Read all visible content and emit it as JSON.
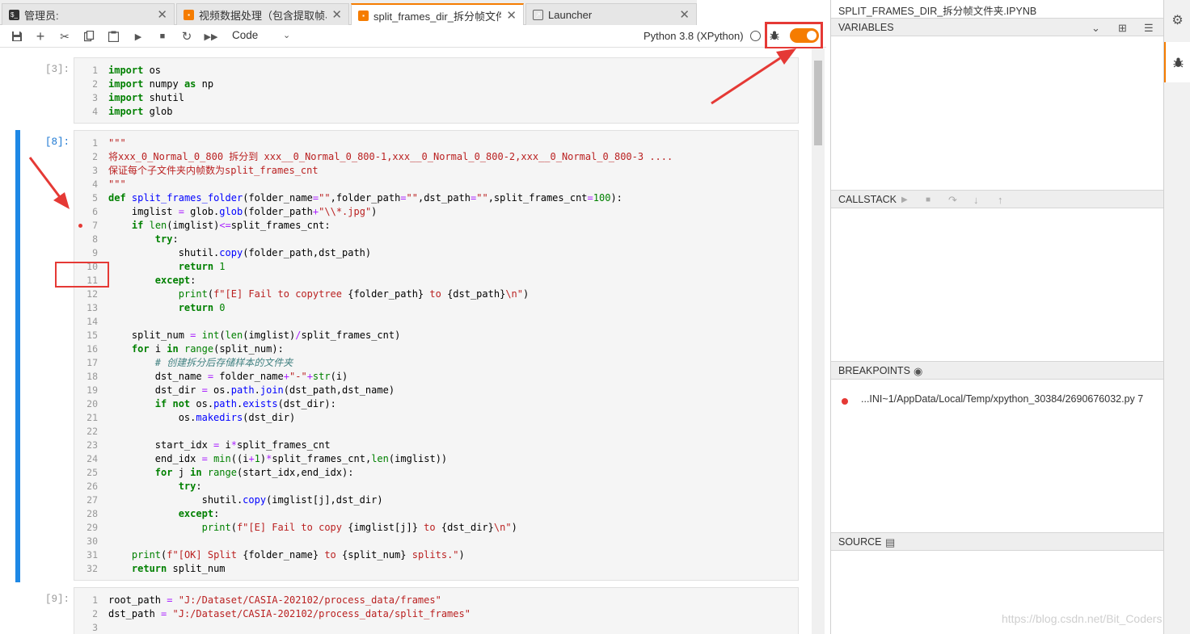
{
  "tabs": [
    {
      "label": "管理员:",
      "icon": "terminal-icon",
      "active": false
    },
    {
      "label": "视频数据处理（包含提取帧、",
      "icon": "notebook-icon",
      "active": false
    },
    {
      "label": "split_frames_dir_拆分帧文件夹",
      "icon": "notebook-icon",
      "active": true
    },
    {
      "label": "Launcher",
      "icon": "launcher-icon",
      "active": false
    }
  ],
  "toolbar": {
    "cell_type": "Code",
    "kernel_name": "Python 3.8 (XPython)"
  },
  "cells": [
    {
      "prompt": "[3]:",
      "lines": [
        [
          [
            "kw",
            "import"
          ],
          [
            "t",
            " os"
          ]
        ],
        [
          [
            "kw",
            "import"
          ],
          [
            "t",
            " numpy "
          ],
          [
            "kw",
            "as"
          ],
          [
            "t",
            " np"
          ]
        ],
        [
          [
            "kw",
            "import"
          ],
          [
            "t",
            " shutil"
          ]
        ],
        [
          [
            "kw",
            "import"
          ],
          [
            "t",
            " glob"
          ]
        ]
      ]
    },
    {
      "prompt": "[8]:",
      "breakpoint_line": 7,
      "lines": [
        [
          [
            "str",
            "\"\"\""
          ]
        ],
        [
          [
            "str",
            "将xxx_0_Normal_0_800 拆分到 xxx__0_Normal_0_800-1,xxx__0_Normal_0_800-2,xxx__0_Normal_0_800-3 ...."
          ]
        ],
        [
          [
            "str",
            "保证每个子文件夹内帧数为split_frames_cnt"
          ]
        ],
        [
          [
            "str",
            "\"\"\""
          ]
        ],
        [
          [
            "kw",
            "def"
          ],
          [
            "t",
            " "
          ],
          [
            "fn",
            "split_frames_folder"
          ],
          [
            "t",
            "(folder_name"
          ],
          [
            "op",
            "="
          ],
          [
            "str",
            "\"\""
          ],
          [
            "t",
            ",folder_path"
          ],
          [
            "op",
            "="
          ],
          [
            "str",
            "\"\""
          ],
          [
            "t",
            ",dst_path"
          ],
          [
            "op",
            "="
          ],
          [
            "str",
            "\"\""
          ],
          [
            "t",
            ",split_frames_cnt"
          ],
          [
            "op",
            "="
          ],
          [
            "num",
            "100"
          ],
          [
            "t",
            "):"
          ]
        ],
        [
          [
            "t",
            "    imglist "
          ],
          [
            "op",
            "="
          ],
          [
            "t",
            " glob."
          ],
          [
            "fn",
            "glob"
          ],
          [
            "t",
            "(folder_path"
          ],
          [
            "op",
            "+"
          ],
          [
            "str",
            "\"\\\\*.jpg\""
          ],
          [
            "t",
            ")"
          ]
        ],
        [
          [
            "t",
            "    "
          ],
          [
            "kw",
            "if"
          ],
          [
            "t",
            " "
          ],
          [
            "num",
            "len"
          ],
          [
            "t",
            "(imglist)"
          ],
          [
            "op",
            "<="
          ],
          [
            "t",
            "split_frames_cnt:"
          ]
        ],
        [
          [
            "t",
            "        "
          ],
          [
            "kw",
            "try"
          ],
          [
            "t",
            ":"
          ]
        ],
        [
          [
            "t",
            "            shutil."
          ],
          [
            "fn",
            "copy"
          ],
          [
            "t",
            "(folder_path,dst_path)"
          ]
        ],
        [
          [
            "t",
            "            "
          ],
          [
            "kw",
            "return"
          ],
          [
            "t",
            " "
          ],
          [
            "num",
            "1"
          ]
        ],
        [
          [
            "t",
            "        "
          ],
          [
            "kw",
            "except"
          ],
          [
            "t",
            ":"
          ]
        ],
        [
          [
            "t",
            "            "
          ],
          [
            "num",
            "print"
          ],
          [
            "t",
            "("
          ],
          [
            "str",
            "f\"[E] Fail to copytree "
          ],
          [
            "t",
            "{folder_path}"
          ],
          [
            "str",
            " to "
          ],
          [
            "t",
            "{dst_path}"
          ],
          [
            "str",
            "\\n\""
          ],
          [
            "t",
            ")"
          ]
        ],
        [
          [
            "t",
            "            "
          ],
          [
            "kw",
            "return"
          ],
          [
            "t",
            " "
          ],
          [
            "num",
            "0"
          ]
        ],
        [],
        [
          [
            "t",
            "    split_num "
          ],
          [
            "op",
            "="
          ],
          [
            "t",
            " "
          ],
          [
            "num",
            "int"
          ],
          [
            "t",
            "("
          ],
          [
            "num",
            "len"
          ],
          [
            "t",
            "(imglist)"
          ],
          [
            "op",
            "/"
          ],
          [
            "t",
            "split_frames_cnt)"
          ]
        ],
        [
          [
            "t",
            "    "
          ],
          [
            "kw",
            "for"
          ],
          [
            "t",
            " i "
          ],
          [
            "kw",
            "in"
          ],
          [
            "t",
            " "
          ],
          [
            "num",
            "range"
          ],
          [
            "t",
            "(split_num):"
          ]
        ],
        [
          [
            "t",
            "        "
          ],
          [
            "cm",
            "# 创建拆分后存储样本的文件夹"
          ]
        ],
        [
          [
            "t",
            "        dst_name "
          ],
          [
            "op",
            "="
          ],
          [
            "t",
            " folder_name"
          ],
          [
            "op",
            "+"
          ],
          [
            "str",
            "\"-\""
          ],
          [
            "op",
            "+"
          ],
          [
            "num",
            "str"
          ],
          [
            "t",
            "(i)"
          ]
        ],
        [
          [
            "t",
            "        dst_dir "
          ],
          [
            "op",
            "="
          ],
          [
            "t",
            " os."
          ],
          [
            "fn",
            "path"
          ],
          [
            "t",
            "."
          ],
          [
            "fn",
            "join"
          ],
          [
            "t",
            "(dst_path,dst_name)"
          ]
        ],
        [
          [
            "t",
            "        "
          ],
          [
            "kw",
            "if not"
          ],
          [
            "t",
            " os."
          ],
          [
            "fn",
            "path"
          ],
          [
            "t",
            "."
          ],
          [
            "fn",
            "exists"
          ],
          [
            "t",
            "(dst_dir):"
          ]
        ],
        [
          [
            "t",
            "            os."
          ],
          [
            "fn",
            "makedirs"
          ],
          [
            "t",
            "(dst_dir)"
          ]
        ],
        [],
        [
          [
            "t",
            "        start_idx "
          ],
          [
            "op",
            "="
          ],
          [
            "t",
            " i"
          ],
          [
            "op",
            "*"
          ],
          [
            "t",
            "split_frames_cnt"
          ]
        ],
        [
          [
            "t",
            "        end_idx "
          ],
          [
            "op",
            "="
          ],
          [
            "t",
            " "
          ],
          [
            "num",
            "min"
          ],
          [
            "t",
            "((i"
          ],
          [
            "op",
            "+"
          ],
          [
            "num",
            "1"
          ],
          [
            "t",
            ")"
          ],
          [
            "op",
            "*"
          ],
          [
            "t",
            "split_frames_cnt,"
          ],
          [
            "num",
            "len"
          ],
          [
            "t",
            "(imglist))"
          ]
        ],
        [
          [
            "t",
            "        "
          ],
          [
            "kw",
            "for"
          ],
          [
            "t",
            " j "
          ],
          [
            "kw",
            "in"
          ],
          [
            "t",
            " "
          ],
          [
            "num",
            "range"
          ],
          [
            "t",
            "(start_idx,end_idx):"
          ]
        ],
        [
          [
            "t",
            "            "
          ],
          [
            "kw",
            "try"
          ],
          [
            "t",
            ":"
          ]
        ],
        [
          [
            "t",
            "                shutil."
          ],
          [
            "fn",
            "copy"
          ],
          [
            "t",
            "(imglist[j],dst_dir)"
          ]
        ],
        [
          [
            "t",
            "            "
          ],
          [
            "kw",
            "except"
          ],
          [
            "t",
            ":"
          ]
        ],
        [
          [
            "t",
            "                "
          ],
          [
            "num",
            "print"
          ],
          [
            "t",
            "("
          ],
          [
            "str",
            "f\"[E] Fail to copy "
          ],
          [
            "t",
            "{imglist[j]}"
          ],
          [
            "str",
            " to "
          ],
          [
            "t",
            "{dst_dir}"
          ],
          [
            "str",
            "\\n\""
          ],
          [
            "t",
            ")"
          ]
        ],
        [],
        [
          [
            "t",
            "    "
          ],
          [
            "num",
            "print"
          ],
          [
            "t",
            "("
          ],
          [
            "str",
            "f\"[OK] Split "
          ],
          [
            "t",
            "{folder_name}"
          ],
          [
            "str",
            " to "
          ],
          [
            "t",
            "{split_num}"
          ],
          [
            "str",
            " splits.\""
          ],
          [
            "t",
            ")"
          ]
        ],
        [
          [
            "t",
            "    "
          ],
          [
            "kw",
            "return"
          ],
          [
            "t",
            " split_num"
          ]
        ]
      ]
    },
    {
      "prompt": "[9]:",
      "lines": [
        [
          [
            "t",
            "root_path "
          ],
          [
            "op",
            "="
          ],
          [
            "t",
            " "
          ],
          [
            "str",
            "\"J:/Dataset/CASIA-202102/process_data/frames\""
          ]
        ],
        [
          [
            "t",
            "dst_path "
          ],
          [
            "op",
            "="
          ],
          [
            "t",
            " "
          ],
          [
            "str",
            "\"J:/Dataset/CASIA-202102/process_data/split_frames\""
          ]
        ],
        []
      ]
    }
  ],
  "debugger": {
    "notebook_title": "SPLIT_FRAMES_DIR_拆分帧文件夹.IPYNB",
    "variables_title": "VARIABLES",
    "callstack_title": "CALLSTACK",
    "breakpoints_title": "BREAKPOINTS",
    "source_title": "SOURCE",
    "breakpoint_entry": "...INI~1/AppData/Local/Temp/xpython_30384/2690676032.py 7"
  },
  "watermark": "https://blog.csdn.net/Bit_Coders",
  "colors": {
    "accent": "#f57c00",
    "active_cell": "#1e88e5",
    "annotation": "#e53935"
  }
}
